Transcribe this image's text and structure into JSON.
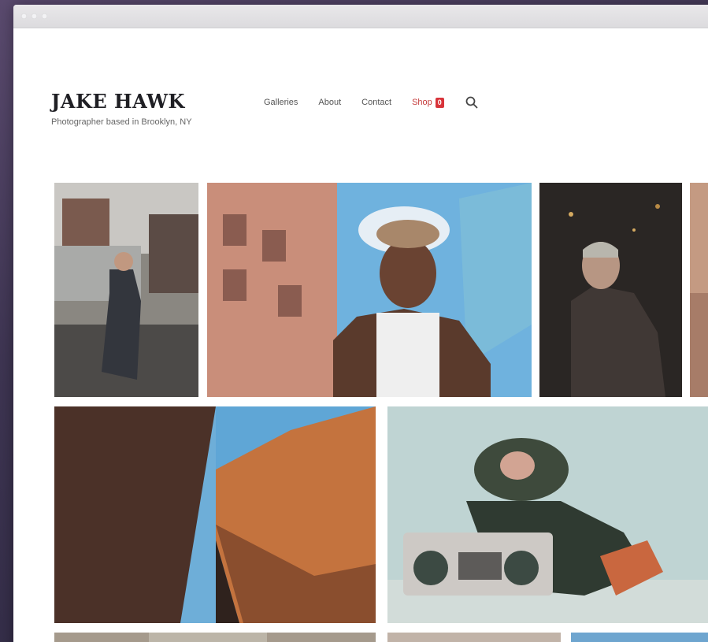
{
  "site": {
    "name": "JAKE HAWK",
    "tagline": "Photographer based in Brooklyn, NY"
  },
  "nav": {
    "items": [
      {
        "label": "Galleries"
      },
      {
        "label": "About"
      },
      {
        "label": "Contact"
      }
    ],
    "shop_label": "Shop",
    "cart_count": "0"
  },
  "icons": {
    "search": "search-icon",
    "cart": "cart-badge"
  },
  "colors": {
    "accent": "#d8343a",
    "title_text": "#1f1f24"
  }
}
